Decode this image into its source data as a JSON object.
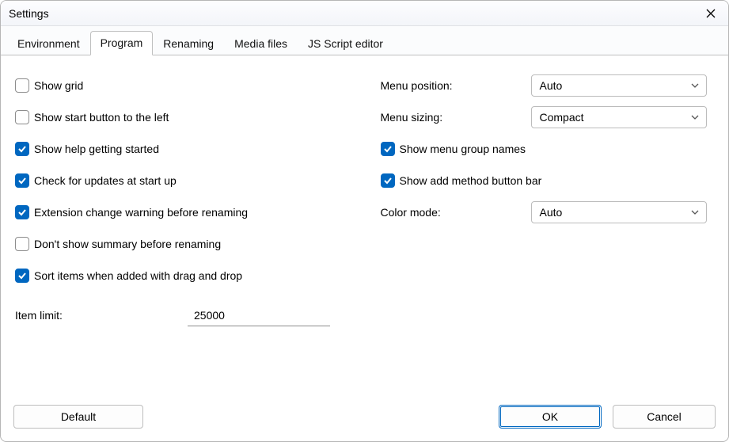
{
  "window": {
    "title": "Settings"
  },
  "tabs": [
    {
      "label": "Environment"
    },
    {
      "label": "Program"
    },
    {
      "label": "Renaming"
    },
    {
      "label": "Media files"
    },
    {
      "label": "JS Script editor"
    }
  ],
  "left": {
    "show_grid": {
      "label": "Show grid",
      "checked": false
    },
    "show_start_left": {
      "label": "Show start button to the left",
      "checked": false
    },
    "show_help": {
      "label": "Show help getting started",
      "checked": true
    },
    "check_updates": {
      "label": "Check for updates at start up",
      "checked": true
    },
    "ext_warn": {
      "label": "Extension change warning before renaming",
      "checked": true
    },
    "no_summary": {
      "label": "Don't show summary before renaming",
      "checked": false
    },
    "sort_drag": {
      "label": "Sort items when added with drag and drop",
      "checked": true
    },
    "item_limit": {
      "label": "Item limit:",
      "value": "25000"
    }
  },
  "right": {
    "menu_position": {
      "label": "Menu position:",
      "value": "Auto"
    },
    "menu_sizing": {
      "label": "Menu sizing:",
      "value": "Compact"
    },
    "show_group_names": {
      "label": "Show menu group names",
      "checked": true
    },
    "show_add_method": {
      "label": "Show add method button bar",
      "checked": true
    },
    "color_mode": {
      "label": "Color mode:",
      "value": "Auto"
    }
  },
  "buttons": {
    "default": "Default",
    "ok": "OK",
    "cancel": "Cancel"
  }
}
